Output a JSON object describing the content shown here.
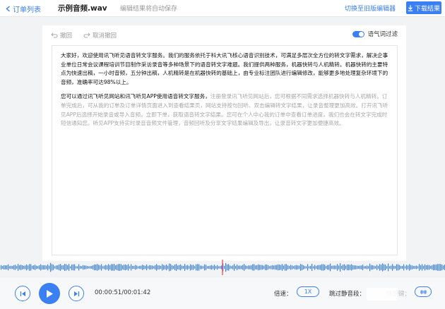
{
  "header": {
    "back_label": "订单列表",
    "file_name": "示例音频.wav",
    "autosave_text": "编辑结果将自动保存",
    "switch_link": "切换至旧版编辑器",
    "download_label": "下载结果"
  },
  "toolbar": {
    "undo_label": "撤回",
    "redo_label": "取消撤回",
    "filler_label": "语气词过滤",
    "filler_on": true
  },
  "editor": {
    "paragraphs": [
      {
        "black": "大家好，欢迎使用讯飞听见语音转文字服务。我们的服务依托于科大讯飞核心语音识别技术，可满足多层次全方位的转文字需求，解决企事业单位日常会议课程培训节目制作采访录音等多种场景下的语音转文字难题。我们提供两种服务，机器快转与人机精转。机器快转的主要特点为快速出稿，一小时音频，五分钟出稿，人机精转是在机器快转的基础上，由专业标注团队进行编辑修改，能够更多地处理复杂环境下的音频，准确率可达98%以上。",
        "gray": ""
      },
      {
        "black": "您可以通过讯飞听见网站和讯飞听见APP使用语音转文字服务，",
        "gray": "注册登录讯飞听见网站后，您可根据不同需求选择机器快转与人机精转。订单完成后，可从我的订单及订单详情页面进入到查看结果页，网站支持按句回听、双击编辑转文字结果，让录音整理更加高效。打开讯飞听见APP后选择开始录音或导入音频，立即下单，获取语音转文字结果。您可在个人中心我的订单中查看订单进度，我们也会在转文字完成时短信通知您。听见APP支持实时录音音频文件管理，音频回听及分享文字结果编辑及导出，让录音转文字更加便捷高效。"
      }
    ]
  },
  "player": {
    "current_time": "00:00:51",
    "total_time": "00:01:42",
    "time_separator": "/",
    "speed_label": "倍速：",
    "speed_value": "1X",
    "skip_silence_label": "跳过静音段：",
    "hotkey_label": "快捷键：",
    "hotkey_icon": "keyboard-icon",
    "progress": 0.5
  },
  "colors": {
    "accent": "#3b7ff5",
    "playhead": "#e0403a"
  }
}
